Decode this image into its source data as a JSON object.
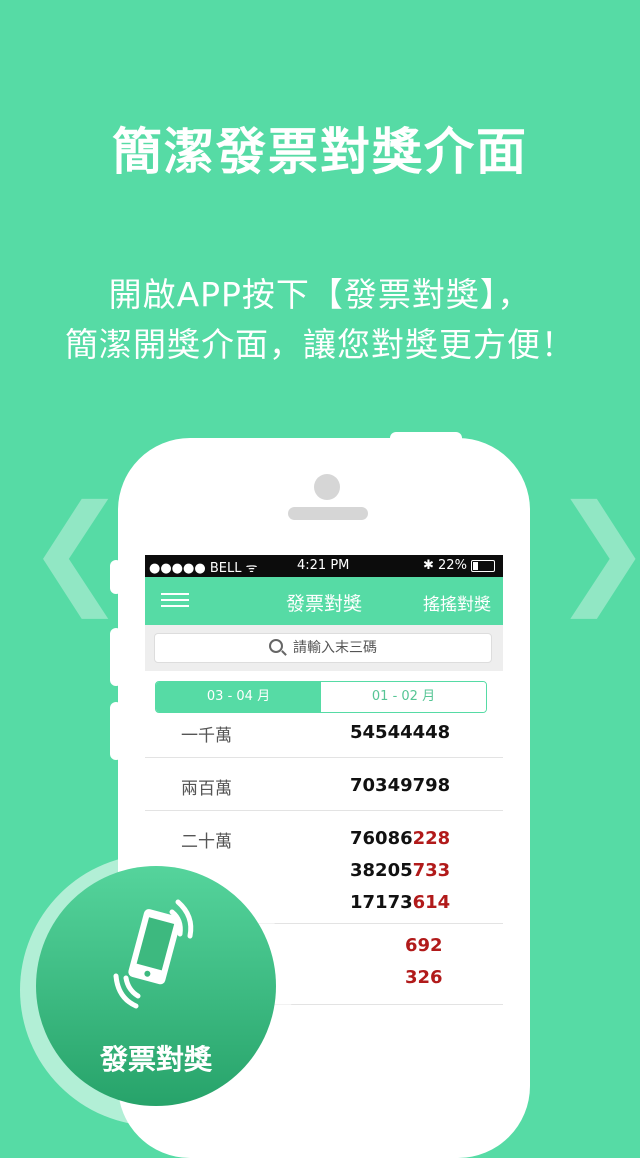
{
  "headline": "簡潔發票對獎介面",
  "subtitle": {
    "line1": "開啟APP按下【發票對獎】，",
    "line2": "簡潔開獎介面，讓您對獎更方便！"
  },
  "arrows": {
    "left": "❮",
    "right": "❯"
  },
  "status_bar": {
    "carrier": "●●●●● BELL ᯤ",
    "time": "4:21 PM",
    "battery": "✱ 22%"
  },
  "nav": {
    "title": "發票對獎",
    "right_action": "搖搖對獎",
    "menu_icon": "hamburger-menu-icon"
  },
  "search": {
    "placeholder": "請輸入末三碼",
    "icon": "search-icon"
  },
  "tabs": [
    {
      "label": "03 - 04 月",
      "active": true
    },
    {
      "label": "01 - 02 月",
      "active": false
    }
  ],
  "prizes": [
    {
      "label": "一千萬",
      "numbers": [
        {
          "prefix": "54544448",
          "suffix": ""
        }
      ]
    },
    {
      "label": "兩百萬",
      "numbers": [
        {
          "prefix": "70349798",
          "suffix": ""
        }
      ]
    },
    {
      "label": "二十萬",
      "numbers": [
        {
          "prefix": "76086",
          "suffix": "228"
        },
        {
          "prefix": "38205",
          "suffix": "733"
        },
        {
          "prefix": "17173",
          "suffix": "614"
        }
      ]
    },
    {
      "label": "",
      "numbers": [
        {
          "prefix": "",
          "suffix": "692"
        },
        {
          "prefix": "",
          "suffix": "326"
        }
      ]
    }
  ],
  "badge": {
    "label": "發票對獎",
    "icon": "shaking-phone-icon"
  },
  "colors": {
    "brand_green": "#56dba5",
    "number_red": "#b11a1a"
  }
}
